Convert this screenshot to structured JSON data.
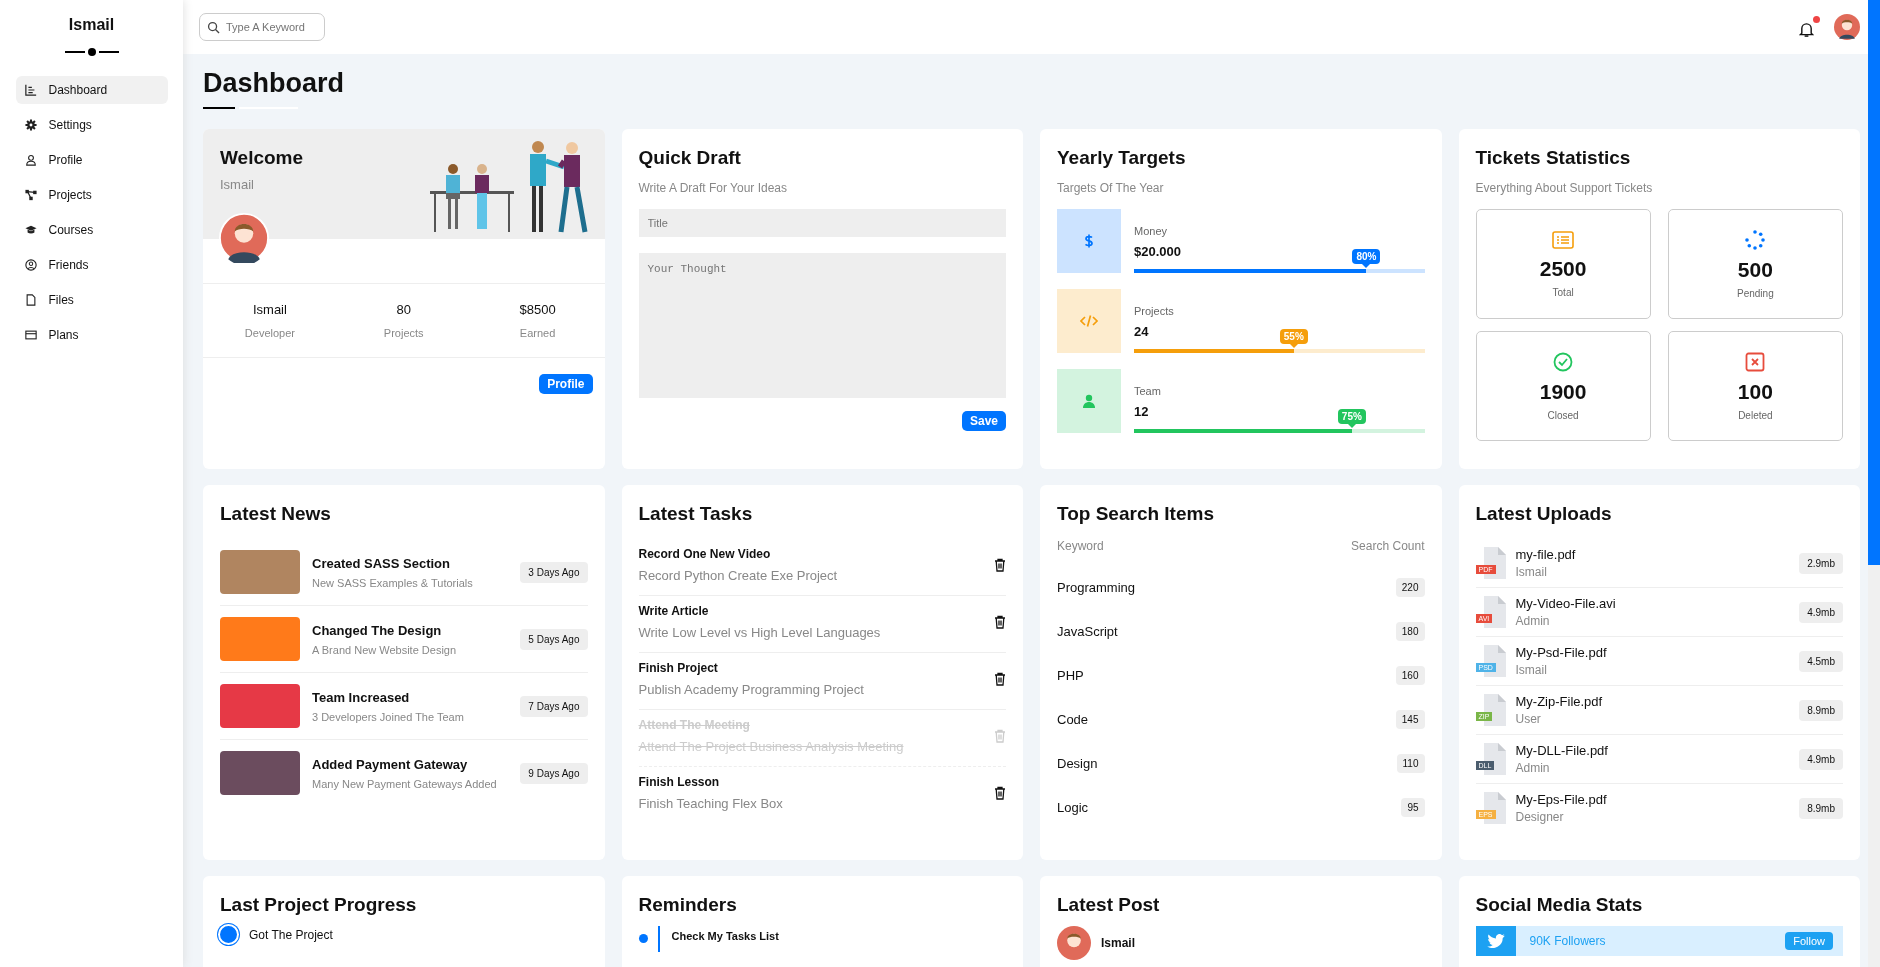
{
  "sidebar": {
    "title": "Ismail",
    "items": [
      {
        "label": "Dashboard",
        "selected": true
      },
      {
        "label": "Settings",
        "selected": false
      },
      {
        "label": "Profile",
        "selected": false
      },
      {
        "label": "Projects",
        "selected": false
      },
      {
        "label": "Courses",
        "selected": false
      },
      {
        "label": "Friends",
        "selected": false
      },
      {
        "label": "Files",
        "selected": false
      },
      {
        "label": "Plans",
        "selected": false
      }
    ]
  },
  "topbar": {
    "search": {
      "placeholder": "Type A Keyword"
    },
    "notifications": {
      "unread": true
    }
  },
  "page_title": "Dashboard",
  "welcome": {
    "title": "Welcome",
    "subtitle": "Ismail",
    "stats": [
      {
        "value": "Ismail",
        "label": "Developer"
      },
      {
        "value": "80",
        "label": "Projects"
      },
      {
        "value": "$8500",
        "label": "Earned"
      }
    ],
    "button": "Profile"
  },
  "quick_draft": {
    "title": "Quick Draft",
    "subtitle": "Write A Draft For Your Ideas",
    "title_field": {
      "placeholder": "Title"
    },
    "body_field": {
      "placeholder": "Your Thought"
    },
    "button": "Save"
  },
  "yearly_targets": {
    "title": "Yearly Targets",
    "subtitle": "Targets Of The Year",
    "targets": [
      {
        "kind": "money",
        "label": "Money",
        "value": "$20.000",
        "level": 0.8,
        "percent": "80%",
        "color": "#0075ff"
      },
      {
        "kind": "code",
        "label": "Projects",
        "value": "24",
        "level": 0.55,
        "percent": "55%",
        "color": "#f59e0b"
      },
      {
        "kind": "team",
        "label": "Team",
        "value": "12",
        "level": 0.75,
        "percent": "75%",
        "color": "#22c55e"
      }
    ]
  },
  "tickets": {
    "title": "Tickets Statistics",
    "subtitle": "Everything About Support Tickets",
    "items": [
      {
        "kind": "total",
        "value": "2500",
        "label": "Total"
      },
      {
        "kind": "pending",
        "value": "500",
        "label": "Pending"
      },
      {
        "kind": "closed",
        "value": "1900",
        "label": "Closed"
      },
      {
        "kind": "deleted",
        "value": "100",
        "label": "Deleted"
      }
    ]
  },
  "latest_news": {
    "title": "Latest News",
    "items": [
      {
        "title": "Created SASS Section",
        "text": "New SASS Examples & Tutorials",
        "age": "3 Days Ago"
      },
      {
        "title": "Changed The Design",
        "text": "A Brand New Website Design",
        "age": "5 Days Ago"
      },
      {
        "title": "Team Increased",
        "text": "3 Developers Joined The Team",
        "age": "7 Days Ago"
      },
      {
        "title": "Added Payment Gateway",
        "text": "Many New Payment Gateways Added",
        "age": "9 Days Ago"
      }
    ]
  },
  "latest_tasks": {
    "title": "Latest Tasks",
    "items": [
      {
        "title": "Record One New Video",
        "text": "Record Python Create Exe Project",
        "done": false
      },
      {
        "title": "Write Article",
        "text": "Write Low Level vs High Level Languages",
        "done": false
      },
      {
        "title": "Finish Project",
        "text": "Publish Academy Programming Project",
        "done": false
      },
      {
        "title": "Attend The Meeting",
        "text": "Attend The Project Business Analysis Meeting",
        "done": true
      },
      {
        "title": "Finish Lesson",
        "text": "Finish Teaching Flex Box",
        "done": false
      }
    ]
  },
  "top_search": {
    "title": "Top Search Items",
    "columns": [
      "Keyword",
      "Search Count"
    ],
    "rows": [
      {
        "keyword": "Programming",
        "count": "220"
      },
      {
        "keyword": "JavaScript",
        "count": "180"
      },
      {
        "keyword": "PHP",
        "count": "160"
      },
      {
        "keyword": "Code",
        "count": "145"
      },
      {
        "keyword": "Design",
        "count": "110"
      },
      {
        "keyword": "Logic",
        "count": "95"
      }
    ]
  },
  "latest_uploads": {
    "title": "Latest Uploads",
    "items": [
      {
        "type": "PDF",
        "color": "#e74c3c",
        "name": "my-file.pdf",
        "owner": "Ismail",
        "size": "2.9mb"
      },
      {
        "type": "AVI",
        "color": "#e74c3c",
        "name": "My-Video-File.avi",
        "owner": "Admin",
        "size": "4.9mb"
      },
      {
        "type": "PSD",
        "color": "#4fb3e8",
        "name": "My-Psd-File.pdf",
        "owner": "Ismail",
        "size": "4.5mb"
      },
      {
        "type": "ZIP",
        "color": "#7ab648",
        "name": "My-Zip-File.pdf",
        "owner": "User",
        "size": "8.9mb"
      },
      {
        "type": "DLL",
        "color": "#4b5d6e",
        "name": "My-DLL-File.pdf",
        "owner": "Admin",
        "size": "4.9mb"
      },
      {
        "type": "EPS",
        "color": "#f5b041",
        "name": "My-Eps-File.pdf",
        "owner": "Designer",
        "size": "8.9mb"
      }
    ]
  },
  "last_project_progress": {
    "title": "Last Project Progress",
    "steps": [
      {
        "label": "Got The Project",
        "done": true
      }
    ]
  },
  "reminders": {
    "title": "Reminders",
    "items": [
      {
        "title": "Check My Tasks List",
        "color": "#0075ff"
      }
    ]
  },
  "latest_post": {
    "title": "Latest Post",
    "author": "Ismail"
  },
  "social_media": {
    "title": "Social Media Stats",
    "items": [
      {
        "followers": "90K Followers",
        "button": "Follow"
      }
    ]
  }
}
